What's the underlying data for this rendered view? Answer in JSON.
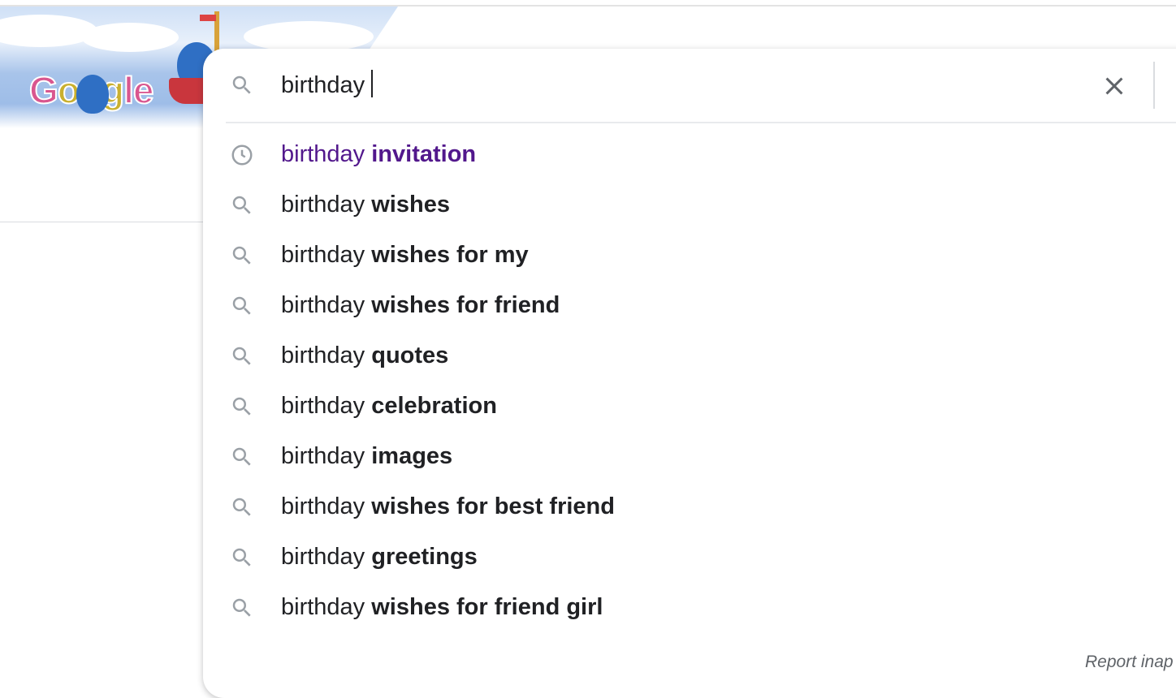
{
  "doodle": {
    "logo_text": "Google"
  },
  "search": {
    "value": "birthday",
    "clear_label": "Clear"
  },
  "suggestions": [
    {
      "prefix": "birthday",
      "completion": "invitation",
      "icon": "history-clock-icon",
      "visited": true
    },
    {
      "prefix": "birthday",
      "completion": "wishes",
      "icon": "search-icon"
    },
    {
      "prefix": "birthday",
      "completion": "wishes for my",
      "icon": "search-icon"
    },
    {
      "prefix": "birthday",
      "completion": "wishes for friend",
      "icon": "search-icon"
    },
    {
      "prefix": "birthday",
      "completion": "quotes",
      "icon": "search-icon"
    },
    {
      "prefix": "birthday",
      "completion": "celebration",
      "icon": "search-icon"
    },
    {
      "prefix": "birthday",
      "completion": "images",
      "icon": "search-icon"
    },
    {
      "prefix": "birthday",
      "completion": "wishes for best friend",
      "icon": "search-icon"
    },
    {
      "prefix": "birthday",
      "completion": "greetings",
      "icon": "search-icon"
    },
    {
      "prefix": "birthday",
      "completion": "wishes for friend girl",
      "icon": "search-icon"
    }
  ],
  "footer": {
    "report_label": "Report inap"
  },
  "colors": {
    "visited": "#52188c",
    "text": "#202124",
    "icon": "#9aa0a6"
  }
}
